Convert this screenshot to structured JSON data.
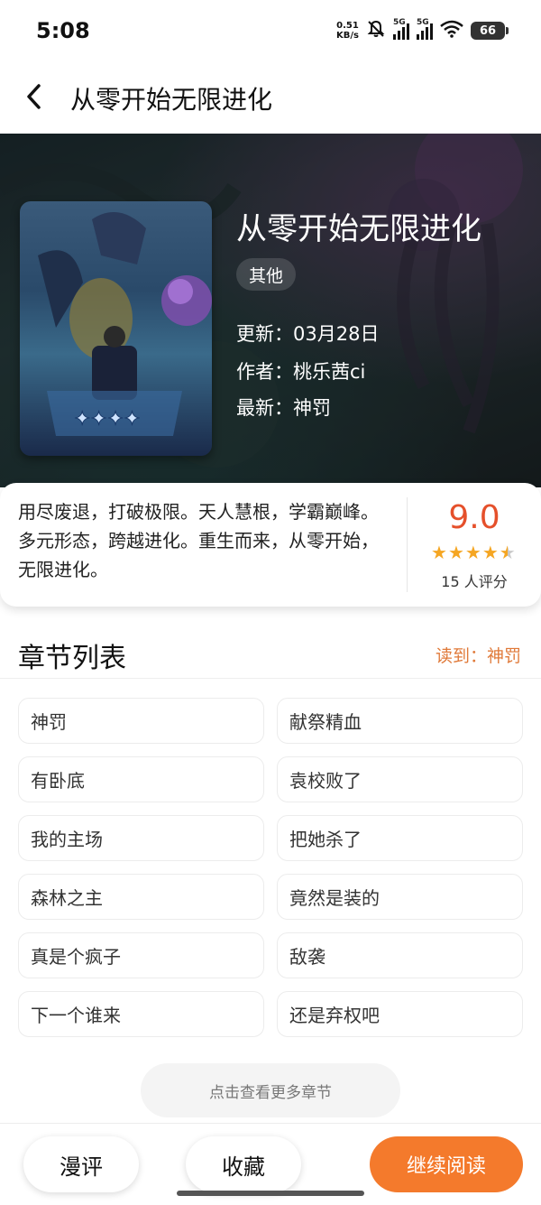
{
  "status_bar": {
    "time": "5:08",
    "net_speed_value": "0.51",
    "net_speed_unit": "KB/s",
    "sim1": "5G",
    "sim2": "5G",
    "battery": "66"
  },
  "nav": {
    "title": "从零开始无限进化"
  },
  "comic": {
    "title": "从零开始无限进化",
    "genre": "其他",
    "updated": "更新：03月28日",
    "author": "作者：桃乐茜ci",
    "latest": "最新：神罚",
    "synopsis": "用尽废退，打破极限。天人慧根，学霸巅峰。多元形态，跨越进化。重生而来，从零开始，无限进化。",
    "rating": "9.0",
    "rating_stars": 4.5,
    "rating_count": "15 人评分",
    "colors": {
      "rating": "#e5502b",
      "star": "#f5a623",
      "accent": "#f47a2c"
    }
  },
  "chapters": {
    "title": "章节列表",
    "read_progress": "读到：神罚",
    "items": [
      "神罚",
      "献祭精血",
      "有卧底",
      "袁校败了",
      "我的主场",
      "把她杀了",
      "森林之主",
      "竟然是装的",
      "真是个疯子",
      "敌袭",
      "下一个谁来",
      "还是弃权吧"
    ],
    "more_label": "点击查看更多章节"
  },
  "bottom_bar": {
    "review_label": "漫评",
    "favorite_label": "收藏",
    "continue_label": "继续阅读"
  }
}
